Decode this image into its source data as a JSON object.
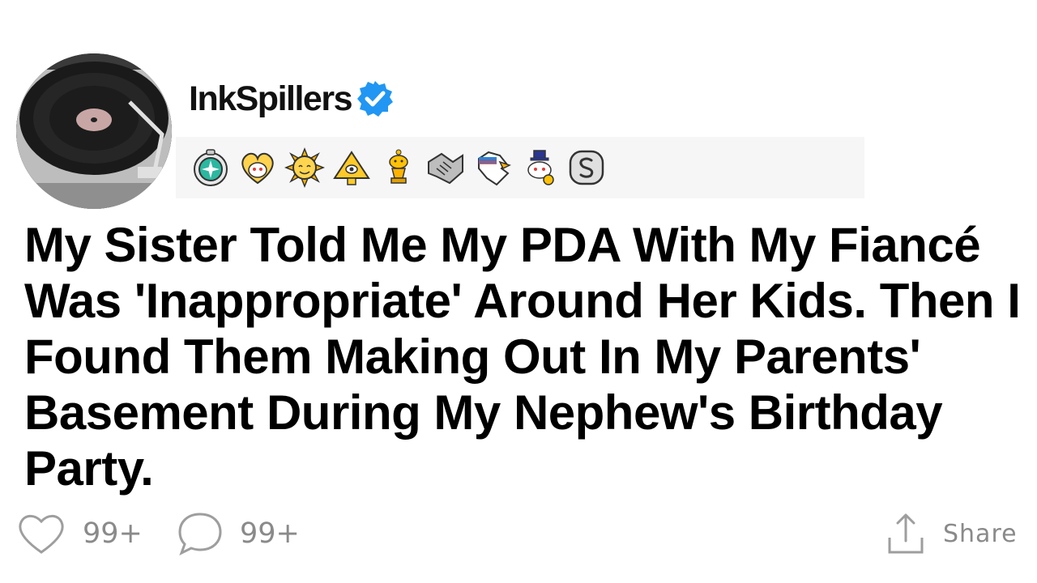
{
  "post": {
    "author": {
      "username": "InkSpillers",
      "verified": true,
      "avatar_icon": "record-player-avatar"
    },
    "awards": [
      "compass-award-icon",
      "heart-snoo-award-icon",
      "sun-award-icon",
      "pyramid-eye-award-icon",
      "gold-trophy-award-icon",
      "handshake-award-icon",
      "eagle-award-icon",
      "snoo-hat-award-icon",
      "silver-s-award-icon"
    ],
    "title": "My Sister Told Me My PDA With My Fiancé Was 'Inappropriate' Around Her Kids. Then I Found Them Making Out In My Parents' Basement During My Nephew's Birthday Party.",
    "likes": "99+",
    "comments": "99+",
    "share_label": "Share"
  },
  "colors": {
    "verified_badge": "#2196f3",
    "footer_text": "#8a8a8a",
    "awards_bar": "#f6f6f6"
  }
}
